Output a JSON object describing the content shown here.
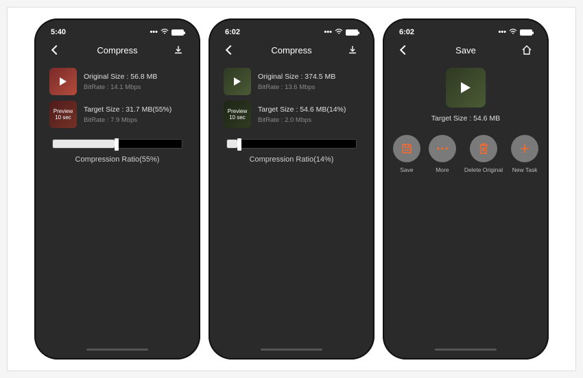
{
  "icons": {
    "preview": "Preview"
  },
  "screens": [
    {
      "time": "5:40",
      "title": "Compress",
      "orig_size": "Original Size : 56.8 MB",
      "orig_bitrate": "BitRate : 14.1 Mbps",
      "target_size": "Target Size : 31.7 MB(55%)",
      "target_bitrate": "BitRate : 7.9 Mbps",
      "preview_dur": "10 sec",
      "ratio_label": "Compression Ratio(55%)",
      "ratio_pct": 55,
      "thumb_variant": "reddish"
    },
    {
      "time": "6:02",
      "title": "Compress",
      "orig_size": "Original Size : 374.5 MB",
      "orig_bitrate": "BitRate : 13.6 Mbps",
      "target_size": "Target Size : 54.6 MB(14%)",
      "target_bitrate": "BitRate : 2.0 Mbps",
      "preview_dur": "10 sec",
      "ratio_label": "Compression Ratio(14%)",
      "ratio_pct": 14,
      "thumb_variant": "green"
    },
    {
      "time": "6:02",
      "title": "Save",
      "target_line": "Target Size : 54.6 MB",
      "actions": [
        {
          "label": "Save",
          "icon": "save"
        },
        {
          "label": "More",
          "icon": "more"
        },
        {
          "label": "Delete Original",
          "icon": "trash"
        },
        {
          "label": "New Task",
          "icon": "plus"
        }
      ]
    }
  ]
}
